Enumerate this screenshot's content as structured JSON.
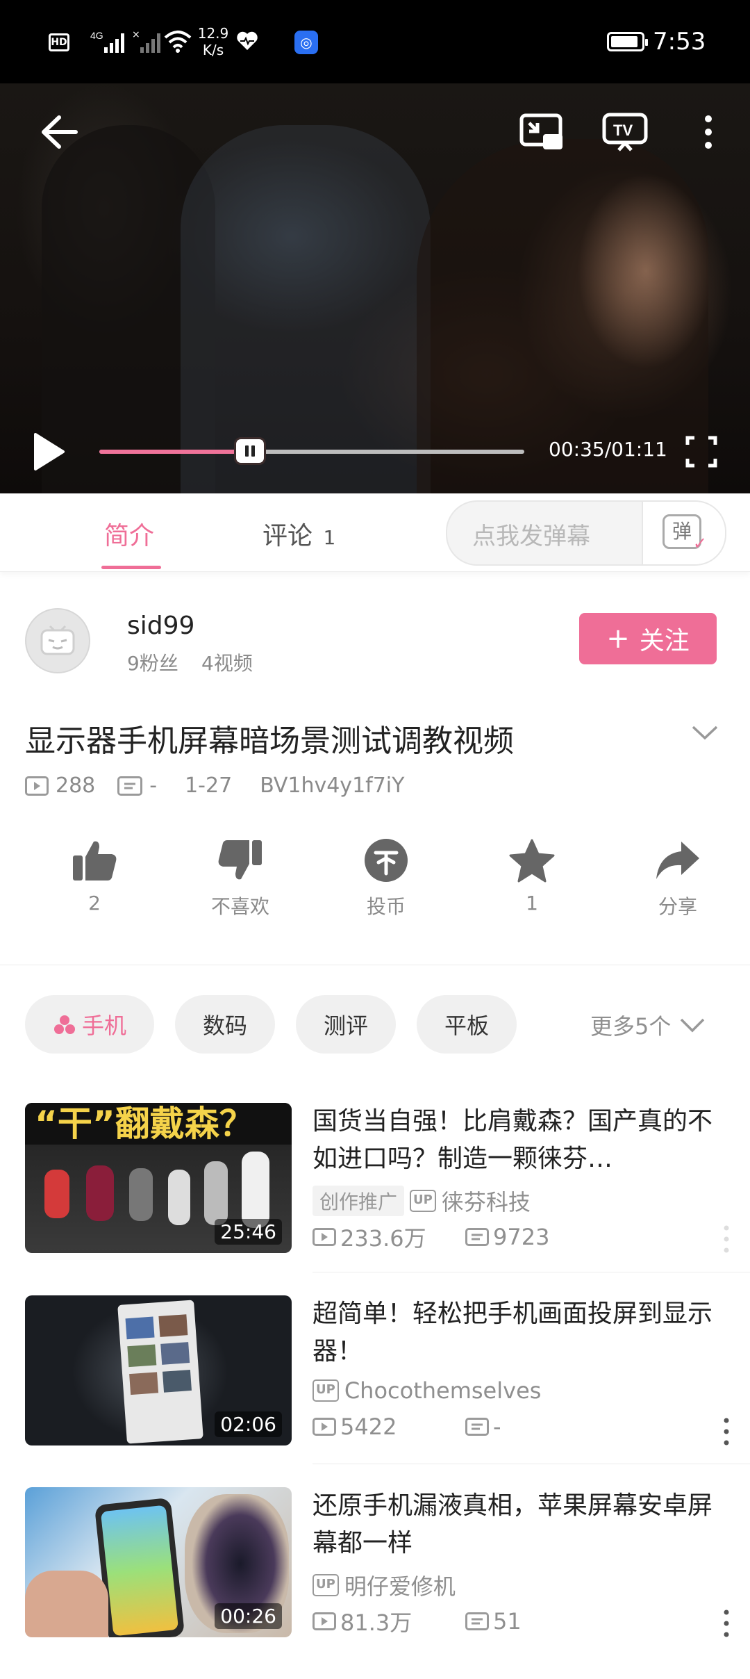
{
  "status": {
    "network_speed_value": "12.9",
    "network_speed_unit": "K/s",
    "time": "7:53"
  },
  "player": {
    "time_current_total": "00:35/01:11",
    "progress": 0.35
  },
  "tabs": {
    "intro": "简介",
    "comments": "评论",
    "comments_count": "1",
    "danmaku_placeholder": "点我发弹幕",
    "danmaku_icon_label": "弹"
  },
  "author": {
    "name": "sid99",
    "fans": "9粉丝",
    "videos": "4视频",
    "follow_label": "关注"
  },
  "video": {
    "title": "显示器手机屏幕暗场景测试调教视频",
    "views": "288",
    "danmaku_count": "-",
    "date": "1-27",
    "bvid": "BV1hv4y1f7iY"
  },
  "actions": [
    {
      "icon": "thumbs-up-icon",
      "label": "2"
    },
    {
      "icon": "thumbs-down-icon",
      "label": "不喜欢"
    },
    {
      "icon": "coin-icon",
      "label": "投币"
    },
    {
      "icon": "star-icon",
      "label": "1"
    },
    {
      "icon": "share-icon",
      "label": "分享"
    }
  ],
  "tags": {
    "items": [
      "手机",
      "数码",
      "测评",
      "平板"
    ],
    "more": "更多5个"
  },
  "recommendations": [
    {
      "thumb_text": "“干”翻戴森？",
      "duration": "25:46",
      "title": "国货当自强！比肩戴森？国产真的不如进口吗？制造一颗徕芬…",
      "promo": "创作推广",
      "up_badge": "UP",
      "uploader": "徕芬科技",
      "views": "233.6万",
      "danmaku": "9723"
    },
    {
      "thumb_text": "",
      "duration": "02:06",
      "title": "超简单！轻松把手机画面投屏到显示器！",
      "promo": "",
      "up_badge": "UP",
      "uploader": "Chocothemselves",
      "views": "5422",
      "danmaku": "-"
    },
    {
      "thumb_text": "",
      "duration": "00:26",
      "title": "还原手机漏液真相，苹果屏幕安卓屏幕都一样",
      "promo": "",
      "up_badge": "UP",
      "uploader": "明仔爱修机",
      "views": "81.3万",
      "danmaku": "51"
    }
  ],
  "colors": {
    "accent": "#ef6e97",
    "progress": "#f0739a",
    "muted": "#8a8a8a"
  }
}
